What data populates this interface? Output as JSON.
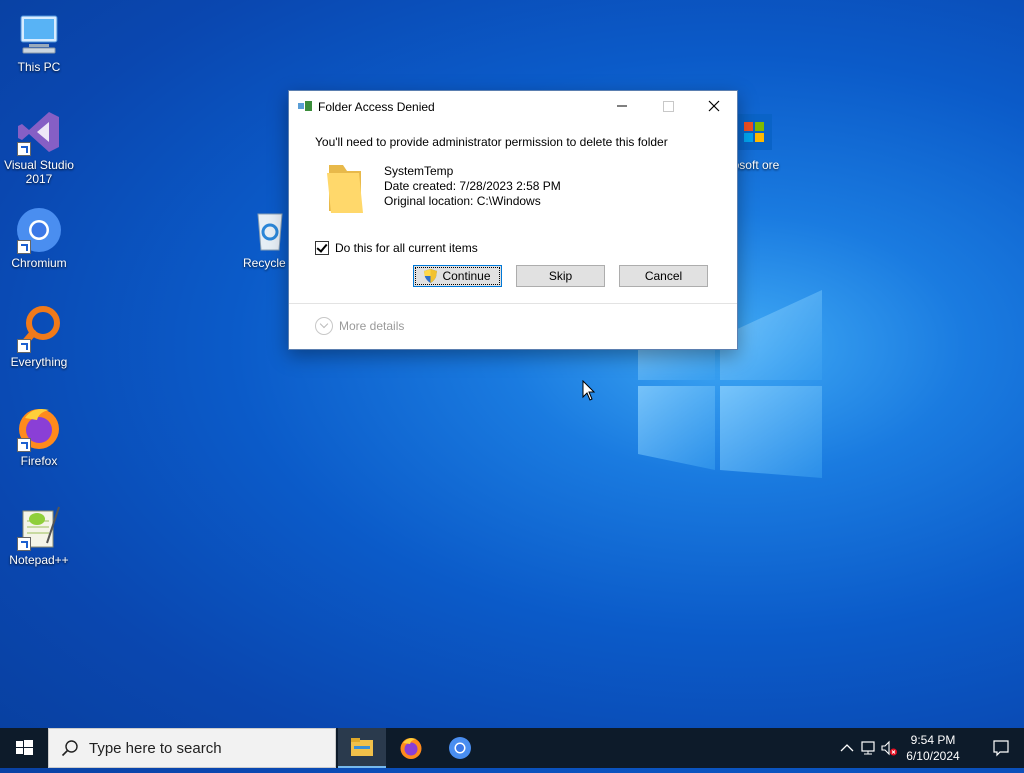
{
  "desktop": {
    "icons": [
      {
        "label": "This PC"
      },
      {
        "label": "Visual Studio 2017"
      },
      {
        "label": "Chromium"
      },
      {
        "label": "Everything"
      },
      {
        "label": "Firefox"
      },
      {
        "label": "Notepad++"
      },
      {
        "label": "Recycle B"
      },
      {
        "label": "rosoft ore"
      }
    ]
  },
  "dialog": {
    "title": "Folder Access Denied",
    "message": "You'll need to provide administrator permission to delete this folder",
    "item": {
      "name": "SystemTemp",
      "date_created": "Date created: 7/28/2023 2:58 PM",
      "original_location": "Original location: C:\\Windows"
    },
    "checkbox_label": "Do this for all current items",
    "checkbox_checked": true,
    "buttons": {
      "continue": "Continue",
      "skip": "Skip",
      "cancel": "Cancel"
    },
    "more_details": "More details"
  },
  "taskbar": {
    "search_placeholder": "Type here to search",
    "apps": [
      "file-explorer-icon",
      "firefox-icon",
      "chromium-icon"
    ],
    "clock": {
      "time": "9:54 PM",
      "date": "6/10/2024"
    }
  },
  "colors": {
    "accent": "#0078d7",
    "taskbar": "#0d1b2a",
    "wallpaper": "#0b5bc9"
  }
}
